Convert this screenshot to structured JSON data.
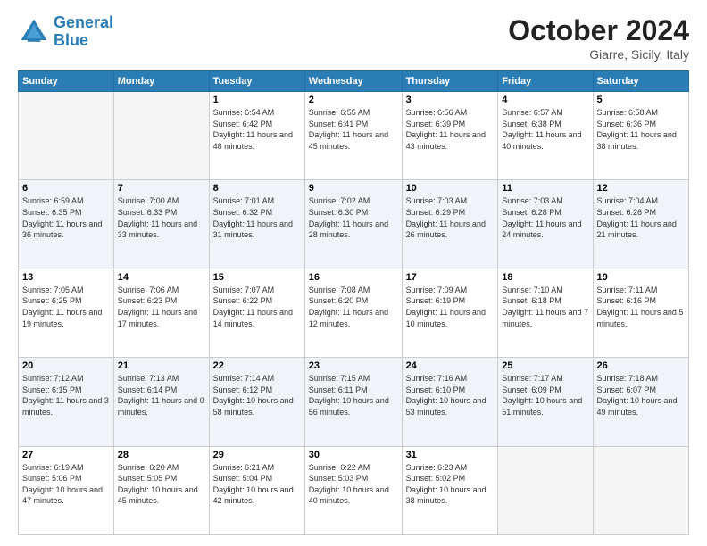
{
  "header": {
    "logo_line1": "General",
    "logo_line2": "Blue",
    "month_title": "October 2024",
    "location": "Giarre, Sicily, Italy"
  },
  "days_of_week": [
    "Sunday",
    "Monday",
    "Tuesday",
    "Wednesday",
    "Thursday",
    "Friday",
    "Saturday"
  ],
  "weeks": [
    [
      {
        "day": "",
        "empty": true
      },
      {
        "day": "",
        "empty": true
      },
      {
        "day": "1",
        "sunrise": "6:54 AM",
        "sunset": "6:42 PM",
        "daylight": "11 hours and 48 minutes."
      },
      {
        "day": "2",
        "sunrise": "6:55 AM",
        "sunset": "6:41 PM",
        "daylight": "11 hours and 45 minutes."
      },
      {
        "day": "3",
        "sunrise": "6:56 AM",
        "sunset": "6:39 PM",
        "daylight": "11 hours and 43 minutes."
      },
      {
        "day": "4",
        "sunrise": "6:57 AM",
        "sunset": "6:38 PM",
        "daylight": "11 hours and 40 minutes."
      },
      {
        "day": "5",
        "sunrise": "6:58 AM",
        "sunset": "6:36 PM",
        "daylight": "11 hours and 38 minutes."
      }
    ],
    [
      {
        "day": "6",
        "sunrise": "6:59 AM",
        "sunset": "6:35 PM",
        "daylight": "11 hours and 36 minutes."
      },
      {
        "day": "7",
        "sunrise": "7:00 AM",
        "sunset": "6:33 PM",
        "daylight": "11 hours and 33 minutes."
      },
      {
        "day": "8",
        "sunrise": "7:01 AM",
        "sunset": "6:32 PM",
        "daylight": "11 hours and 31 minutes."
      },
      {
        "day": "9",
        "sunrise": "7:02 AM",
        "sunset": "6:30 PM",
        "daylight": "11 hours and 28 minutes."
      },
      {
        "day": "10",
        "sunrise": "7:03 AM",
        "sunset": "6:29 PM",
        "daylight": "11 hours and 26 minutes."
      },
      {
        "day": "11",
        "sunrise": "7:03 AM",
        "sunset": "6:28 PM",
        "daylight": "11 hours and 24 minutes."
      },
      {
        "day": "12",
        "sunrise": "7:04 AM",
        "sunset": "6:26 PM",
        "daylight": "11 hours and 21 minutes."
      }
    ],
    [
      {
        "day": "13",
        "sunrise": "7:05 AM",
        "sunset": "6:25 PM",
        "daylight": "11 hours and 19 minutes."
      },
      {
        "day": "14",
        "sunrise": "7:06 AM",
        "sunset": "6:23 PM",
        "daylight": "11 hours and 17 minutes."
      },
      {
        "day": "15",
        "sunrise": "7:07 AM",
        "sunset": "6:22 PM",
        "daylight": "11 hours and 14 minutes."
      },
      {
        "day": "16",
        "sunrise": "7:08 AM",
        "sunset": "6:20 PM",
        "daylight": "11 hours and 12 minutes."
      },
      {
        "day": "17",
        "sunrise": "7:09 AM",
        "sunset": "6:19 PM",
        "daylight": "11 hours and 10 minutes."
      },
      {
        "day": "18",
        "sunrise": "7:10 AM",
        "sunset": "6:18 PM",
        "daylight": "11 hours and 7 minutes."
      },
      {
        "day": "19",
        "sunrise": "7:11 AM",
        "sunset": "6:16 PM",
        "daylight": "11 hours and 5 minutes."
      }
    ],
    [
      {
        "day": "20",
        "sunrise": "7:12 AM",
        "sunset": "6:15 PM",
        "daylight": "11 hours and 3 minutes."
      },
      {
        "day": "21",
        "sunrise": "7:13 AM",
        "sunset": "6:14 PM",
        "daylight": "11 hours and 0 minutes."
      },
      {
        "day": "22",
        "sunrise": "7:14 AM",
        "sunset": "6:12 PM",
        "daylight": "10 hours and 58 minutes."
      },
      {
        "day": "23",
        "sunrise": "7:15 AM",
        "sunset": "6:11 PM",
        "daylight": "10 hours and 56 minutes."
      },
      {
        "day": "24",
        "sunrise": "7:16 AM",
        "sunset": "6:10 PM",
        "daylight": "10 hours and 53 minutes."
      },
      {
        "day": "25",
        "sunrise": "7:17 AM",
        "sunset": "6:09 PM",
        "daylight": "10 hours and 51 minutes."
      },
      {
        "day": "26",
        "sunrise": "7:18 AM",
        "sunset": "6:07 PM",
        "daylight": "10 hours and 49 minutes."
      }
    ],
    [
      {
        "day": "27",
        "sunrise": "6:19 AM",
        "sunset": "5:06 PM",
        "daylight": "10 hours and 47 minutes."
      },
      {
        "day": "28",
        "sunrise": "6:20 AM",
        "sunset": "5:05 PM",
        "daylight": "10 hours and 45 minutes."
      },
      {
        "day": "29",
        "sunrise": "6:21 AM",
        "sunset": "5:04 PM",
        "daylight": "10 hours and 42 minutes."
      },
      {
        "day": "30",
        "sunrise": "6:22 AM",
        "sunset": "5:03 PM",
        "daylight": "10 hours and 40 minutes."
      },
      {
        "day": "31",
        "sunrise": "6:23 AM",
        "sunset": "5:02 PM",
        "daylight": "10 hours and 38 minutes."
      },
      {
        "day": "",
        "empty": true
      },
      {
        "day": "",
        "empty": true
      }
    ]
  ],
  "labels": {
    "sunrise": "Sunrise:",
    "sunset": "Sunset:",
    "daylight": "Daylight:"
  }
}
